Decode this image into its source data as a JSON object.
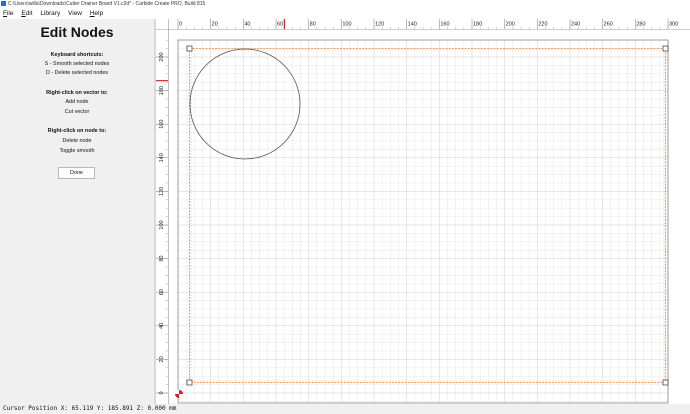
{
  "window": {
    "title": "C:\\Users\\willa\\Downloads\\Cutter Drainer Board V1.c2d* - Carbide Create PRO, Build 815"
  },
  "menu": [
    {
      "label": "File",
      "mnemonic": "F",
      "rest": "ile"
    },
    {
      "label": "Edit",
      "mnemonic": "E",
      "rest": "dit"
    },
    {
      "label": "Library",
      "mnemonic": "",
      "rest": "Library"
    },
    {
      "label": "View",
      "mnemonic": "",
      "rest": "View"
    },
    {
      "label": "Help",
      "mnemonic": "H",
      "rest": "elp"
    }
  ],
  "panel": {
    "title": "Edit Nodes",
    "keyboard_heading": "Keyboard shortcuts:",
    "shortcut_smooth": "S - Smooth selected nodes",
    "shortcut_delete": "D - Delete selected nodes",
    "vector_heading": "Right-click on vector to:",
    "vector_add": "Add node",
    "vector_cut": "Cut vector",
    "node_heading": "Right-click on node to:",
    "node_delete": "Delete node",
    "node_toggle": "Toggle smooth",
    "done_label": "Done"
  },
  "rulers": {
    "x_ticks": [
      "0",
      "20",
      "40",
      "60",
      "80",
      "100",
      "120",
      "140",
      "160",
      "180",
      "200",
      "220",
      "240",
      "260",
      "280",
      "300"
    ],
    "y_ticks": [
      "0",
      "20",
      "40",
      "60",
      "80",
      "100",
      "120",
      "140",
      "160",
      "180",
      "200"
    ],
    "cursor_x_mm": 65.119,
    "cursor_y_mm": 185.891
  },
  "status": {
    "cursor_text": "Cursor Position X: 65.119 Y: 185.891 Z: 0.000 mm"
  },
  "colors": {
    "grid_minor": "#e6e6e6",
    "grid_major": "#cfcfcf",
    "selection": "#e8823a",
    "cursor_marker": "#d42020"
  }
}
